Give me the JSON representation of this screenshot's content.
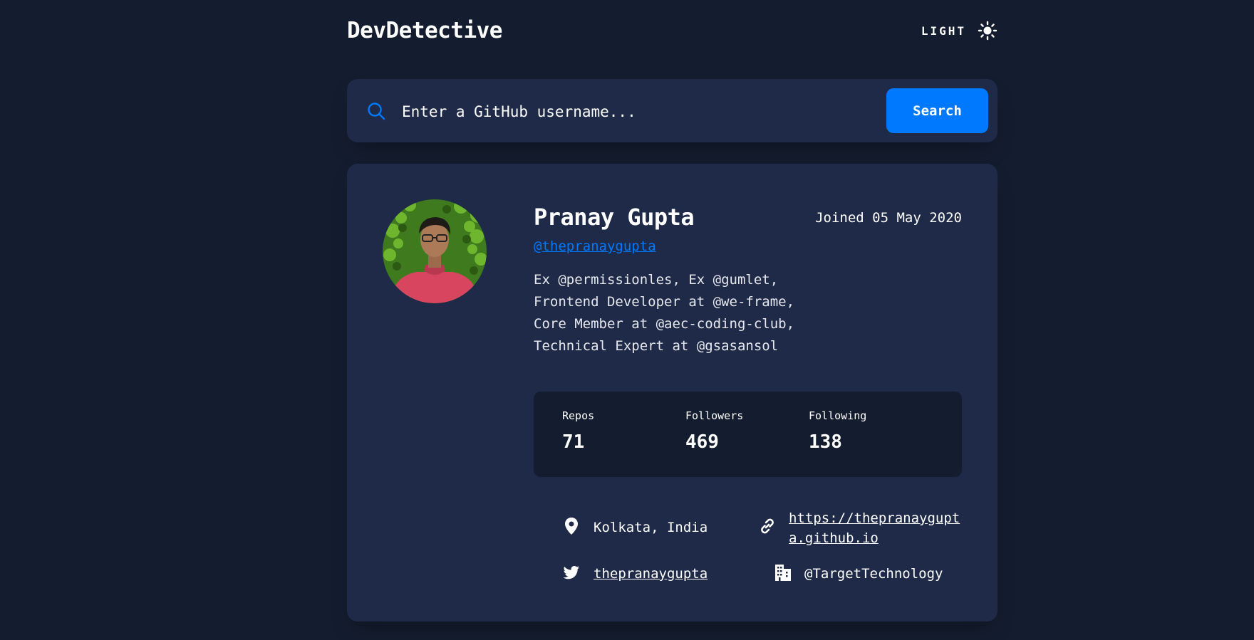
{
  "header": {
    "logo": "DevDetective",
    "theme_label": "LIGHT",
    "theme_icon": "sun-icon"
  },
  "search": {
    "placeholder": "Enter a GitHub username...",
    "button_label": "Search",
    "icon": "search-icon"
  },
  "profile": {
    "name": "Pranay Gupta",
    "joined": "Joined 05 May 2020",
    "login": "@thepranaygupta",
    "bio_lines": [
      "Ex @permissionles, Ex @gumlet,",
      "Frontend Developer at @we-frame,",
      "Core Member at @aec-coding-club,",
      "Technical Expert at @gsasansol"
    ],
    "stats": [
      {
        "label": "Repos",
        "value": "71"
      },
      {
        "label": "Followers",
        "value": "469"
      },
      {
        "label": "Following",
        "value": "138"
      }
    ],
    "location": "Kolkata, India",
    "website_line1": "https://thepranaygupt",
    "website_line2": "a.github.io",
    "twitter": "thepranaygupta",
    "company": "@TargetTechnology"
  },
  "colors": {
    "background": "#141d2f",
    "card": "#1e2a47",
    "accent": "#0079ff",
    "text": "#ffffff"
  }
}
